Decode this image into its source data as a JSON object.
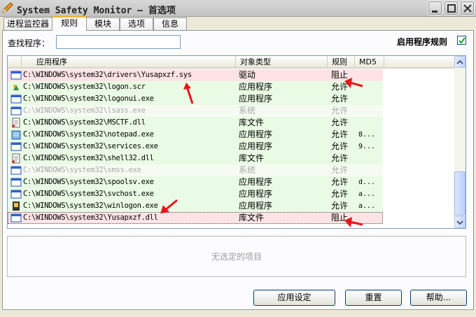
{
  "window": {
    "title": "System Safety Monitor — 首选项",
    "controls": [
      "minimize-icon",
      "maximize-icon",
      "close-icon"
    ]
  },
  "tabs": [
    {
      "label": "进程监控器",
      "active": false
    },
    {
      "label": "规则",
      "active": true
    },
    {
      "label": "模块",
      "active": false
    },
    {
      "label": "选项",
      "active": false
    },
    {
      "label": "信息",
      "active": false
    }
  ],
  "search": {
    "label": "查找程序：",
    "value": ""
  },
  "enable_rules": {
    "label": "启用程序规则",
    "checked": true
  },
  "table": {
    "columns": [
      "应用程序",
      "对象类型",
      "规则",
      "MD5"
    ],
    "rows": [
      {
        "path": "C:\\WINDOWS\\system32\\drivers\\Yusapxzf.sys",
        "type": "驱动",
        "rule": "阻止",
        "md5": "",
        "status": "block",
        "icon": "driver-icon"
      },
      {
        "path": "C:\\WINDOWS\\system32\\logon.scr",
        "type": "应用程序",
        "rule": "允许",
        "md5": "",
        "status": "allow",
        "icon": "screensaver-icon"
      },
      {
        "path": "C:\\WINDOWS\\system32\\logonui.exe",
        "type": "应用程序",
        "rule": "允许",
        "md5": "",
        "status": "allow",
        "icon": "window-icon"
      },
      {
        "path": "C:\\WINDOWS\\system32\\lsass.exe",
        "type": "系统",
        "rule": "允许",
        "md5": "",
        "status": "system",
        "icon": "window-icon"
      },
      {
        "path": "C:\\WINDOWS\\system32\\MSCTF.dll",
        "type": "库文件",
        "rule": "允许",
        "md5": "",
        "status": "allow",
        "icon": "dll-icon"
      },
      {
        "path": "C:\\WINDOWS\\system32\\notepad.exe",
        "type": "应用程序",
        "rule": "允许",
        "md5": "8...",
        "status": "allow",
        "icon": "notepad-icon"
      },
      {
        "path": "C:\\WINDOWS\\system32\\services.exe",
        "type": "应用程序",
        "rule": "允许",
        "md5": "9...",
        "status": "allow",
        "icon": "window-icon"
      },
      {
        "path": "C:\\WINDOWS\\system32\\shell32.dll",
        "type": "库文件",
        "rule": "允许",
        "md5": "",
        "status": "allow",
        "icon": "dll-icon"
      },
      {
        "path": "C:\\WINDOWS\\system32\\smss.exe",
        "type": "系统",
        "rule": "允许",
        "md5": "",
        "status": "system",
        "icon": "window-icon"
      },
      {
        "path": "C:\\WINDOWS\\system32\\spoolsv.exe",
        "type": "应用程序",
        "rule": "允许",
        "md5": "d...",
        "status": "allow",
        "icon": "window-icon"
      },
      {
        "path": "C:\\WINDOWS\\system32\\svchost.exe",
        "type": "应用程序",
        "rule": "允许",
        "md5": "a...",
        "status": "allow",
        "icon": "window-icon"
      },
      {
        "path": "C:\\WINDOWS\\system32\\winlogon.exe",
        "type": "应用程序",
        "rule": "允许",
        "md5": "a...",
        "status": "allow",
        "icon": "winlogon-icon"
      },
      {
        "path": "C:\\WINDOWS\\system32\\Yusapxzf.dll",
        "type": "库文件",
        "rule": "阻止",
        "md5": "",
        "status": "block",
        "icon": "window-icon"
      }
    ]
  },
  "details": {
    "empty_text": "无选定的项目"
  },
  "buttons": {
    "app_settings": "应用设定",
    "reset": "重置",
    "help": "帮助..."
  },
  "colors": {
    "allow_row": "#e9fbe4",
    "block_row": "#fde3e5",
    "arrow": "#e8141b"
  }
}
